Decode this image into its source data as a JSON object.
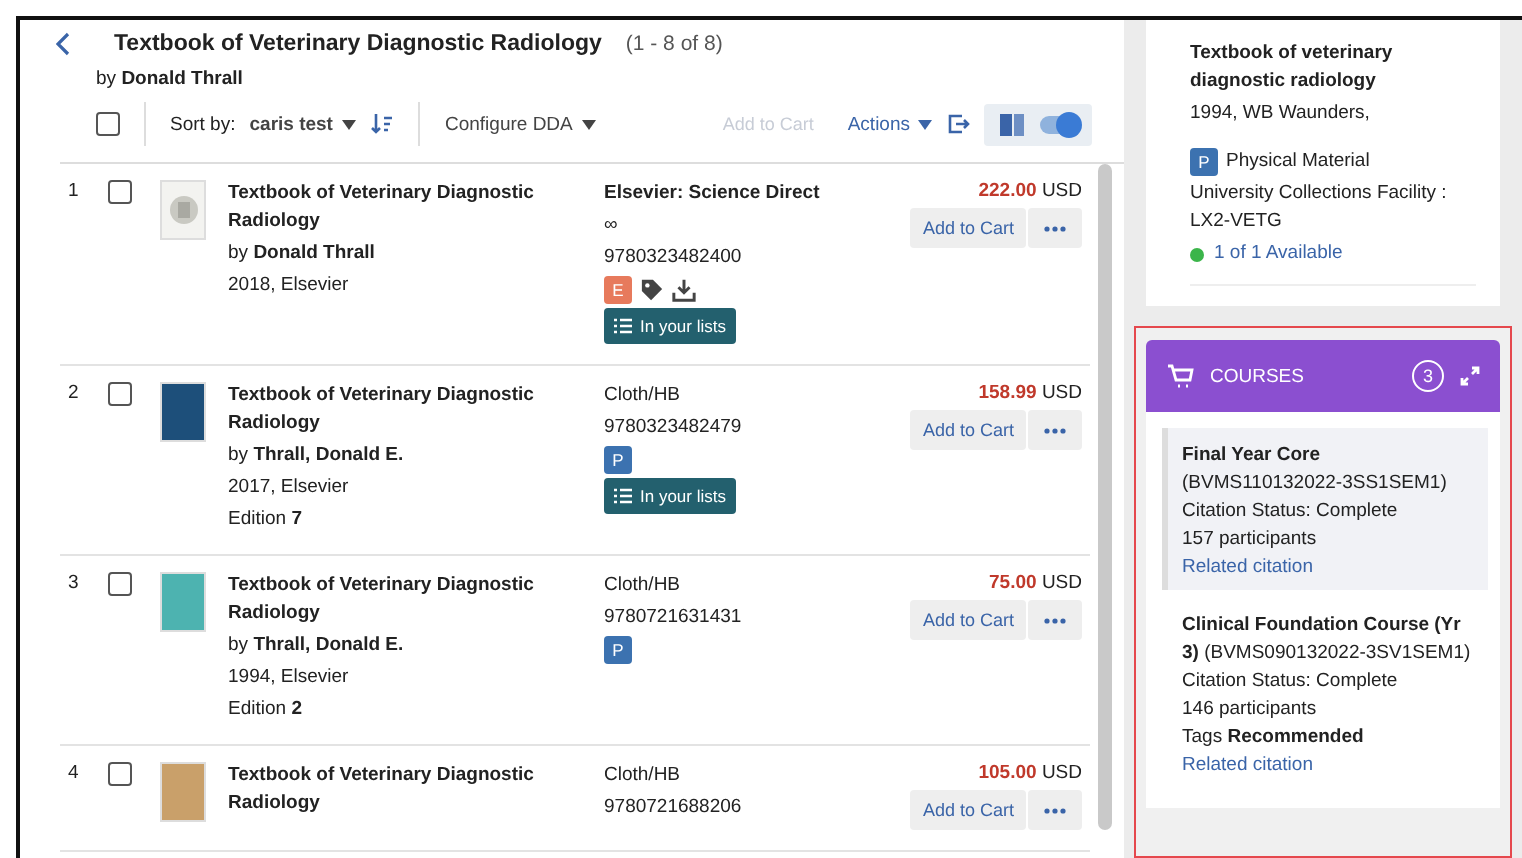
{
  "header": {
    "title": "Textbook of Veterinary Diagnostic Radiology",
    "count": "(1 - 8 of 8)",
    "author": "by **Donald Thrall**"
  },
  "toolbar": {
    "select_all_checked": false,
    "sort_label": "Sort by:",
    "sort_value": "caris test",
    "configure": "Configure DDA",
    "add_to_cart": "Add to Cart",
    "add_to_cart_disabled": true,
    "actions": "Actions",
    "view_toggle_on": true
  },
  "items": [
    {
      "number": "1",
      "checked": false,
      "kind": "electronic",
      "color": "#f3f3f0",
      "title": "Textbook of Veterinary Diagnostic Radiology",
      "author": "by **Donald Thrall**",
      "year_publisher": "2018, Elsevier",
      "format": "Elsevier: Science Direct",
      "extra": "∞",
      "isbn": "9780323482400",
      "badges": [
        {
          "kind": "e",
          "label": "E"
        },
        {
          "kind": "tag"
        },
        {
          "kind": "download"
        }
      ],
      "in_lists": "In your lists",
      "price": "222.00",
      "currency": "USD",
      "add": "Add to Cart"
    },
    {
      "number": "2",
      "checked": false,
      "kind": "physical",
      "color": "#1d4f7a",
      "title": "Textbook of Veterinary Diagnostic Radiology",
      "author": "by **Thrall, Donald E.**",
      "year_publisher": "2017, Elsevier",
      "edition": "Edition **7**",
      "format": "Cloth/HB",
      "isbn": "9780323482479",
      "badges": [
        {
          "kind": "p",
          "label": "P"
        }
      ],
      "in_lists": "In your lists",
      "price": "158.99",
      "currency": "USD",
      "add": "Add to Cart"
    },
    {
      "number": "3",
      "checked": false,
      "kind": "physical",
      "color": "#4db3b0",
      "title": "Textbook of Veterinary Diagnostic Radiology",
      "author": "by **Thrall, Donald E.**",
      "year_publisher": "1994, Elsevier",
      "edition": "Edition **2**",
      "format": "Cloth/HB",
      "isbn": "9780721631431",
      "badges": [
        {
          "kind": "p",
          "label": "P"
        }
      ],
      "price": "75.00",
      "currency": "USD",
      "add": "Add to Cart"
    },
    {
      "number": "4",
      "checked": false,
      "kind": "physical",
      "color": "#c9a06a",
      "title": "Textbook of Veterinary Diagnostic Radiology",
      "format": "Cloth/HB",
      "isbn": "9780721688206",
      "price": "105.00",
      "currency": "USD",
      "add": "Add to Cart"
    }
  ],
  "holding": {
    "title": "Textbook of veterinary diagnostic radiology",
    "year_publisher": "1994, WB Waunders,",
    "badge": "P",
    "material": "Physical Material",
    "location": "University Collections Facility : LX2-VETG",
    "availability": "1 of 1 Available",
    "available": true
  },
  "courses": {
    "title": "COURSES",
    "count": "3",
    "items": [
      {
        "name": "**Final Year Core** (BVMS110132022-3SS1SEM1)",
        "status": "Citation Status: Complete",
        "participants": "157 participants",
        "link": "Related citation",
        "selected": true
      },
      {
        "name": "**Clinical Foundation Course (Yr 3)** (BVMS090132022-3SV1SEM1)",
        "status": "Citation Status: Complete",
        "participants": "146 participants",
        "tags": "Tags  **Recommended**",
        "link": "Related citation",
        "selected": false
      }
    ]
  }
}
